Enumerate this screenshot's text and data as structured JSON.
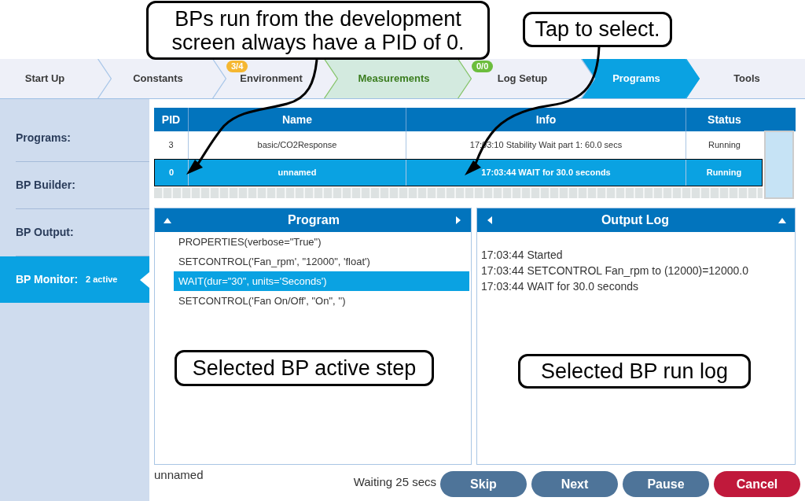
{
  "callouts": [
    {
      "text": "BPs run from the development screen always have a PID of 0."
    },
    {
      "text": "Tap to select."
    },
    {
      "text": "Selected BP active step"
    },
    {
      "text": "Selected BP run log"
    }
  ],
  "tabs": [
    {
      "label": "Start Up",
      "selected": false,
      "highlighted": false
    },
    {
      "label": "Constants",
      "selected": false,
      "highlighted": false
    },
    {
      "label": "Environment",
      "selected": false,
      "highlighted": false,
      "badge": {
        "text": "3/4",
        "color": "#f5b731"
      }
    },
    {
      "label": "Measurements",
      "selected": false,
      "highlighted": true
    },
    {
      "label": "Log Setup",
      "selected": false,
      "highlighted": false,
      "badge": {
        "text": "0/0",
        "color": "#6cbd3d"
      }
    },
    {
      "label": "Programs",
      "selected": true,
      "highlighted": false
    },
    {
      "label": "Tools",
      "selected": false,
      "highlighted": false
    }
  ],
  "sidebar": {
    "items": [
      {
        "label": "Programs:",
        "selected": false
      },
      {
        "label": "BP Builder:",
        "selected": false
      },
      {
        "label": "BP Output:",
        "selected": false
      },
      {
        "label": "BP Monitor:",
        "selected": true,
        "count": "2 active"
      }
    ]
  },
  "table": {
    "columns": [
      "PID",
      "Name",
      "Info",
      "Status"
    ],
    "rows": [
      {
        "cells": [
          "3",
          "basic/CO2Response",
          "17:03:10 Stability Wait part 1: 60.0 secs",
          "Running"
        ],
        "selected": false
      },
      {
        "cells": [
          "0",
          "unnamed",
          "17:03:44 WAIT for 30.0 seconds",
          "Running"
        ],
        "selected": true
      }
    ]
  },
  "program_panel": {
    "title": "Program",
    "steps": [
      {
        "text": "PROPERTIES(verbose=\"True\")",
        "selected": false
      },
      {
        "text": "SETCONTROL('Fan_rpm', \"12000\", 'float')",
        "selected": false
      },
      {
        "text": "WAIT(dur=\"30\", units='Seconds')",
        "selected": true
      },
      {
        "text": "SETCONTROL('Fan On/Off', \"On\", '')",
        "selected": false
      }
    ]
  },
  "output_log": {
    "title": "Output Log",
    "lines": [
      "17:03:44 Started",
      "17:03:44 SETCONTROL Fan_rpm to (12000)=12000.0",
      "17:03:44 WAIT for 30.0 seconds"
    ]
  },
  "footer": {
    "program_name": "unnamed",
    "status": "Waiting 25 secs",
    "buttons": [
      {
        "label": "Skip",
        "kind": "normal"
      },
      {
        "label": "Next",
        "kind": "normal"
      },
      {
        "label": "Pause",
        "kind": "normal"
      },
      {
        "label": "Cancel",
        "kind": "danger"
      }
    ]
  }
}
